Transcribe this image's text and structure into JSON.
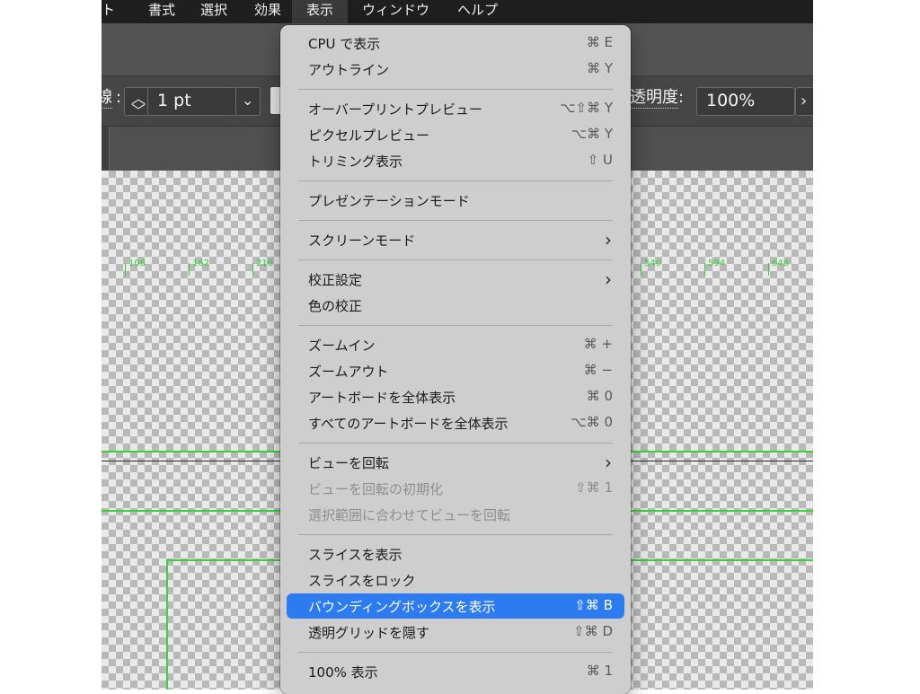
{
  "menubar": {
    "items": [
      "ト",
      "書式",
      "選択",
      "効果",
      "表示",
      "ウィンドウ",
      "ヘルプ"
    ],
    "active_index": 4
  },
  "toolbar": {
    "stroke_label": "線",
    "stroke_value": "1 pt",
    "opacity_label": "透明度",
    "opacity_value": "100%",
    "more_arrow": "›"
  },
  "ruler": {
    "labels": [
      "108",
      "162",
      "216",
      "540",
      "594",
      "648"
    ],
    "color": "#3bd13b"
  },
  "view_menu": {
    "highlight_color": "#2d7bf0",
    "items": [
      {
        "label": "CPU で表示",
        "shortcut": "⌘ E"
      },
      {
        "label": "アウトライン",
        "shortcut": "⌘ Y"
      },
      {
        "label": "オーバープリントプレビュー",
        "shortcut": "⌥⇧⌘ Y"
      },
      {
        "label": "ピクセルプレビュー",
        "shortcut": "⌥⌘ Y"
      },
      {
        "label": "トリミング表示",
        "shortcut": "⇧ U"
      },
      {
        "label": "プレゼンテーションモード",
        "shortcut": ""
      },
      {
        "label": "スクリーンモード",
        "shortcut": "",
        "submenu": true
      },
      {
        "label": "校正設定",
        "shortcut": "",
        "submenu": true
      },
      {
        "label": "色の校正",
        "shortcut": ""
      },
      {
        "label": "ズームイン",
        "shortcut": "⌘ +"
      },
      {
        "label": "ズームアウト",
        "shortcut": "⌘ −"
      },
      {
        "label": "アートボードを全体表示",
        "shortcut": "⌘ 0"
      },
      {
        "label": "すべてのアートボードを全体表示",
        "shortcut": "⌥⌘ 0"
      },
      {
        "label": "ビューを回転",
        "shortcut": "",
        "submenu": true
      },
      {
        "label": "ビューを回転の初期化",
        "shortcut": "⇧⌘ 1",
        "disabled": true
      },
      {
        "label": "選択範囲に合わせてビューを回転",
        "shortcut": "",
        "disabled": true
      },
      {
        "label": "スライスを表示",
        "shortcut": ""
      },
      {
        "label": "スライスをロック",
        "shortcut": ""
      },
      {
        "label": "バウンディングボックスを表示",
        "shortcut": "⇧⌘ B",
        "highlighted": true
      },
      {
        "label": "透明グリッドを隠す",
        "shortcut": "⇧⌘ D"
      },
      {
        "label": "100% 表示",
        "shortcut": "⌘ 1"
      }
    ]
  }
}
